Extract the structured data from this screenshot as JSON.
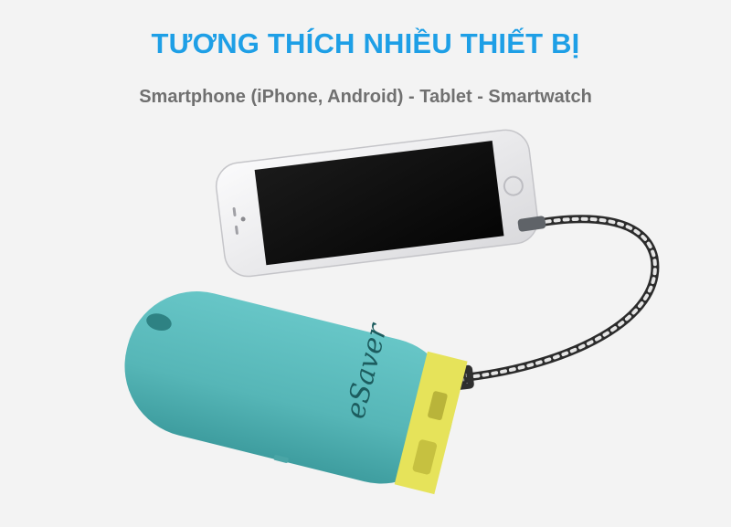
{
  "headline": "TƯƠNG THÍCH NHIỀU THIẾT BỊ",
  "subline": "Smartphone (iPhone, Android) - Tablet - Smartwatch",
  "product": {
    "brand": "eSaver",
    "body_color": "#5bbcbd",
    "port_color": "#e6e35a"
  },
  "phone": {
    "body_color": "#e8e8ea",
    "screen_color": "#0c0c0c"
  },
  "icons": [
    "power-bank",
    "smartphone",
    "charging-cable"
  ]
}
